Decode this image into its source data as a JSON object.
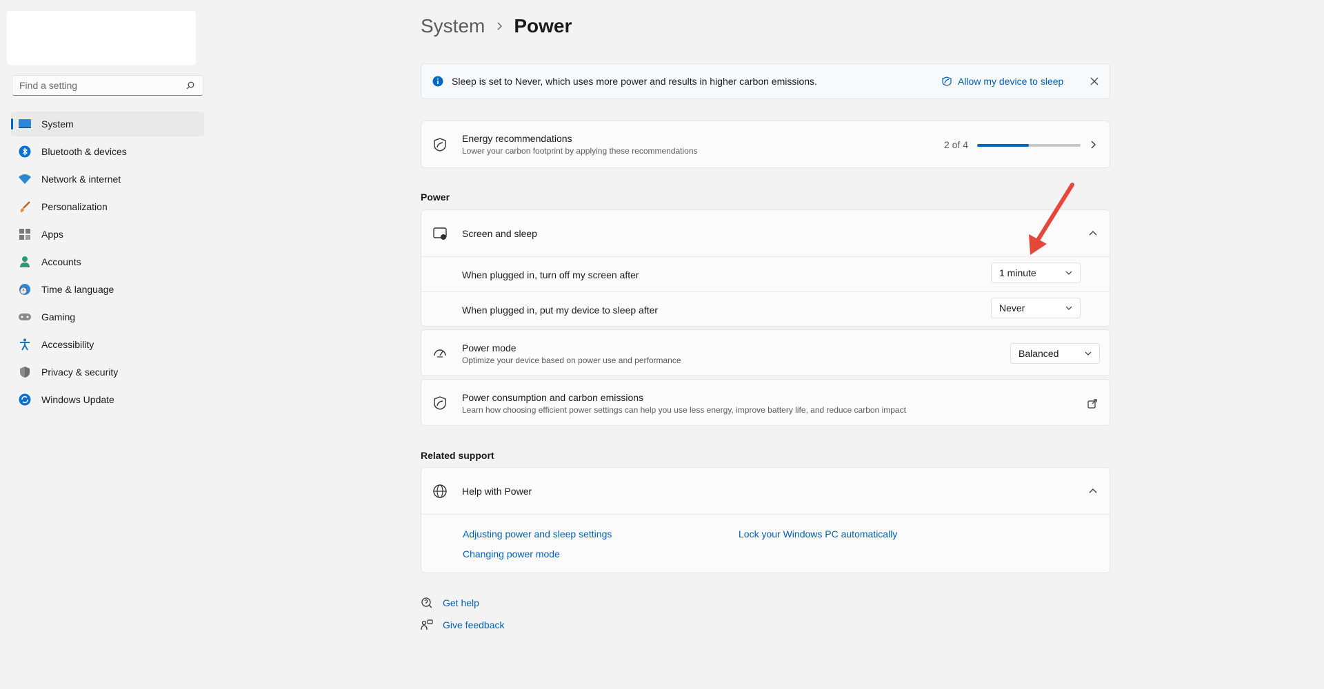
{
  "search": {
    "placeholder": "Find a setting"
  },
  "sidebar": {
    "items": [
      {
        "label": "System",
        "icon": "system-icon",
        "selected": true
      },
      {
        "label": "Bluetooth & devices",
        "icon": "bluetooth-icon"
      },
      {
        "label": "Network & internet",
        "icon": "wifi-icon"
      },
      {
        "label": "Personalization",
        "icon": "brush-icon"
      },
      {
        "label": "Apps",
        "icon": "apps-icon"
      },
      {
        "label": "Accounts",
        "icon": "accounts-icon"
      },
      {
        "label": "Time & language",
        "icon": "globe-clock-icon"
      },
      {
        "label": "Gaming",
        "icon": "gamepad-icon"
      },
      {
        "label": "Accessibility",
        "icon": "accessibility-icon"
      },
      {
        "label": "Privacy & security",
        "icon": "shield-icon"
      },
      {
        "label": "Windows Update",
        "icon": "update-icon"
      }
    ]
  },
  "breadcrumb": {
    "parent": "System",
    "current": "Power"
  },
  "info_bar": {
    "text": "Sleep is set to Never, which uses more power and results in higher carbon emissions.",
    "action": "Allow my device to sleep"
  },
  "energy": {
    "title": "Energy recommendations",
    "subtitle": "Lower your carbon footprint by applying these recommendations",
    "progress_text": "2 of 4",
    "progress_done": 2,
    "progress_total": 4
  },
  "power_section": {
    "label": "Power",
    "screen_sleep": {
      "title": "Screen and sleep",
      "rows": [
        {
          "label": "When plugged in, turn off my screen after",
          "value": "1 minute"
        },
        {
          "label": "When plugged in, put my device to sleep after",
          "value": "Never"
        }
      ]
    },
    "power_mode": {
      "title": "Power mode",
      "subtitle": "Optimize your device based on power use and performance",
      "value": "Balanced"
    },
    "consumption": {
      "title": "Power consumption and carbon emissions",
      "subtitle": "Learn how choosing efficient power settings can help you use less energy, improve battery life, and reduce carbon impact"
    }
  },
  "related": {
    "label": "Related support",
    "help": {
      "title": "Help with Power",
      "links": [
        "Adjusting power and sleep settings",
        "Lock your Windows PC automatically",
        "Changing power mode"
      ]
    }
  },
  "footer": {
    "get_help": "Get help",
    "give_feedback": "Give feedback"
  },
  "colors": {
    "accent": "#0067c0",
    "link": "#005fb8",
    "annotation_arrow": "#e5473a"
  }
}
